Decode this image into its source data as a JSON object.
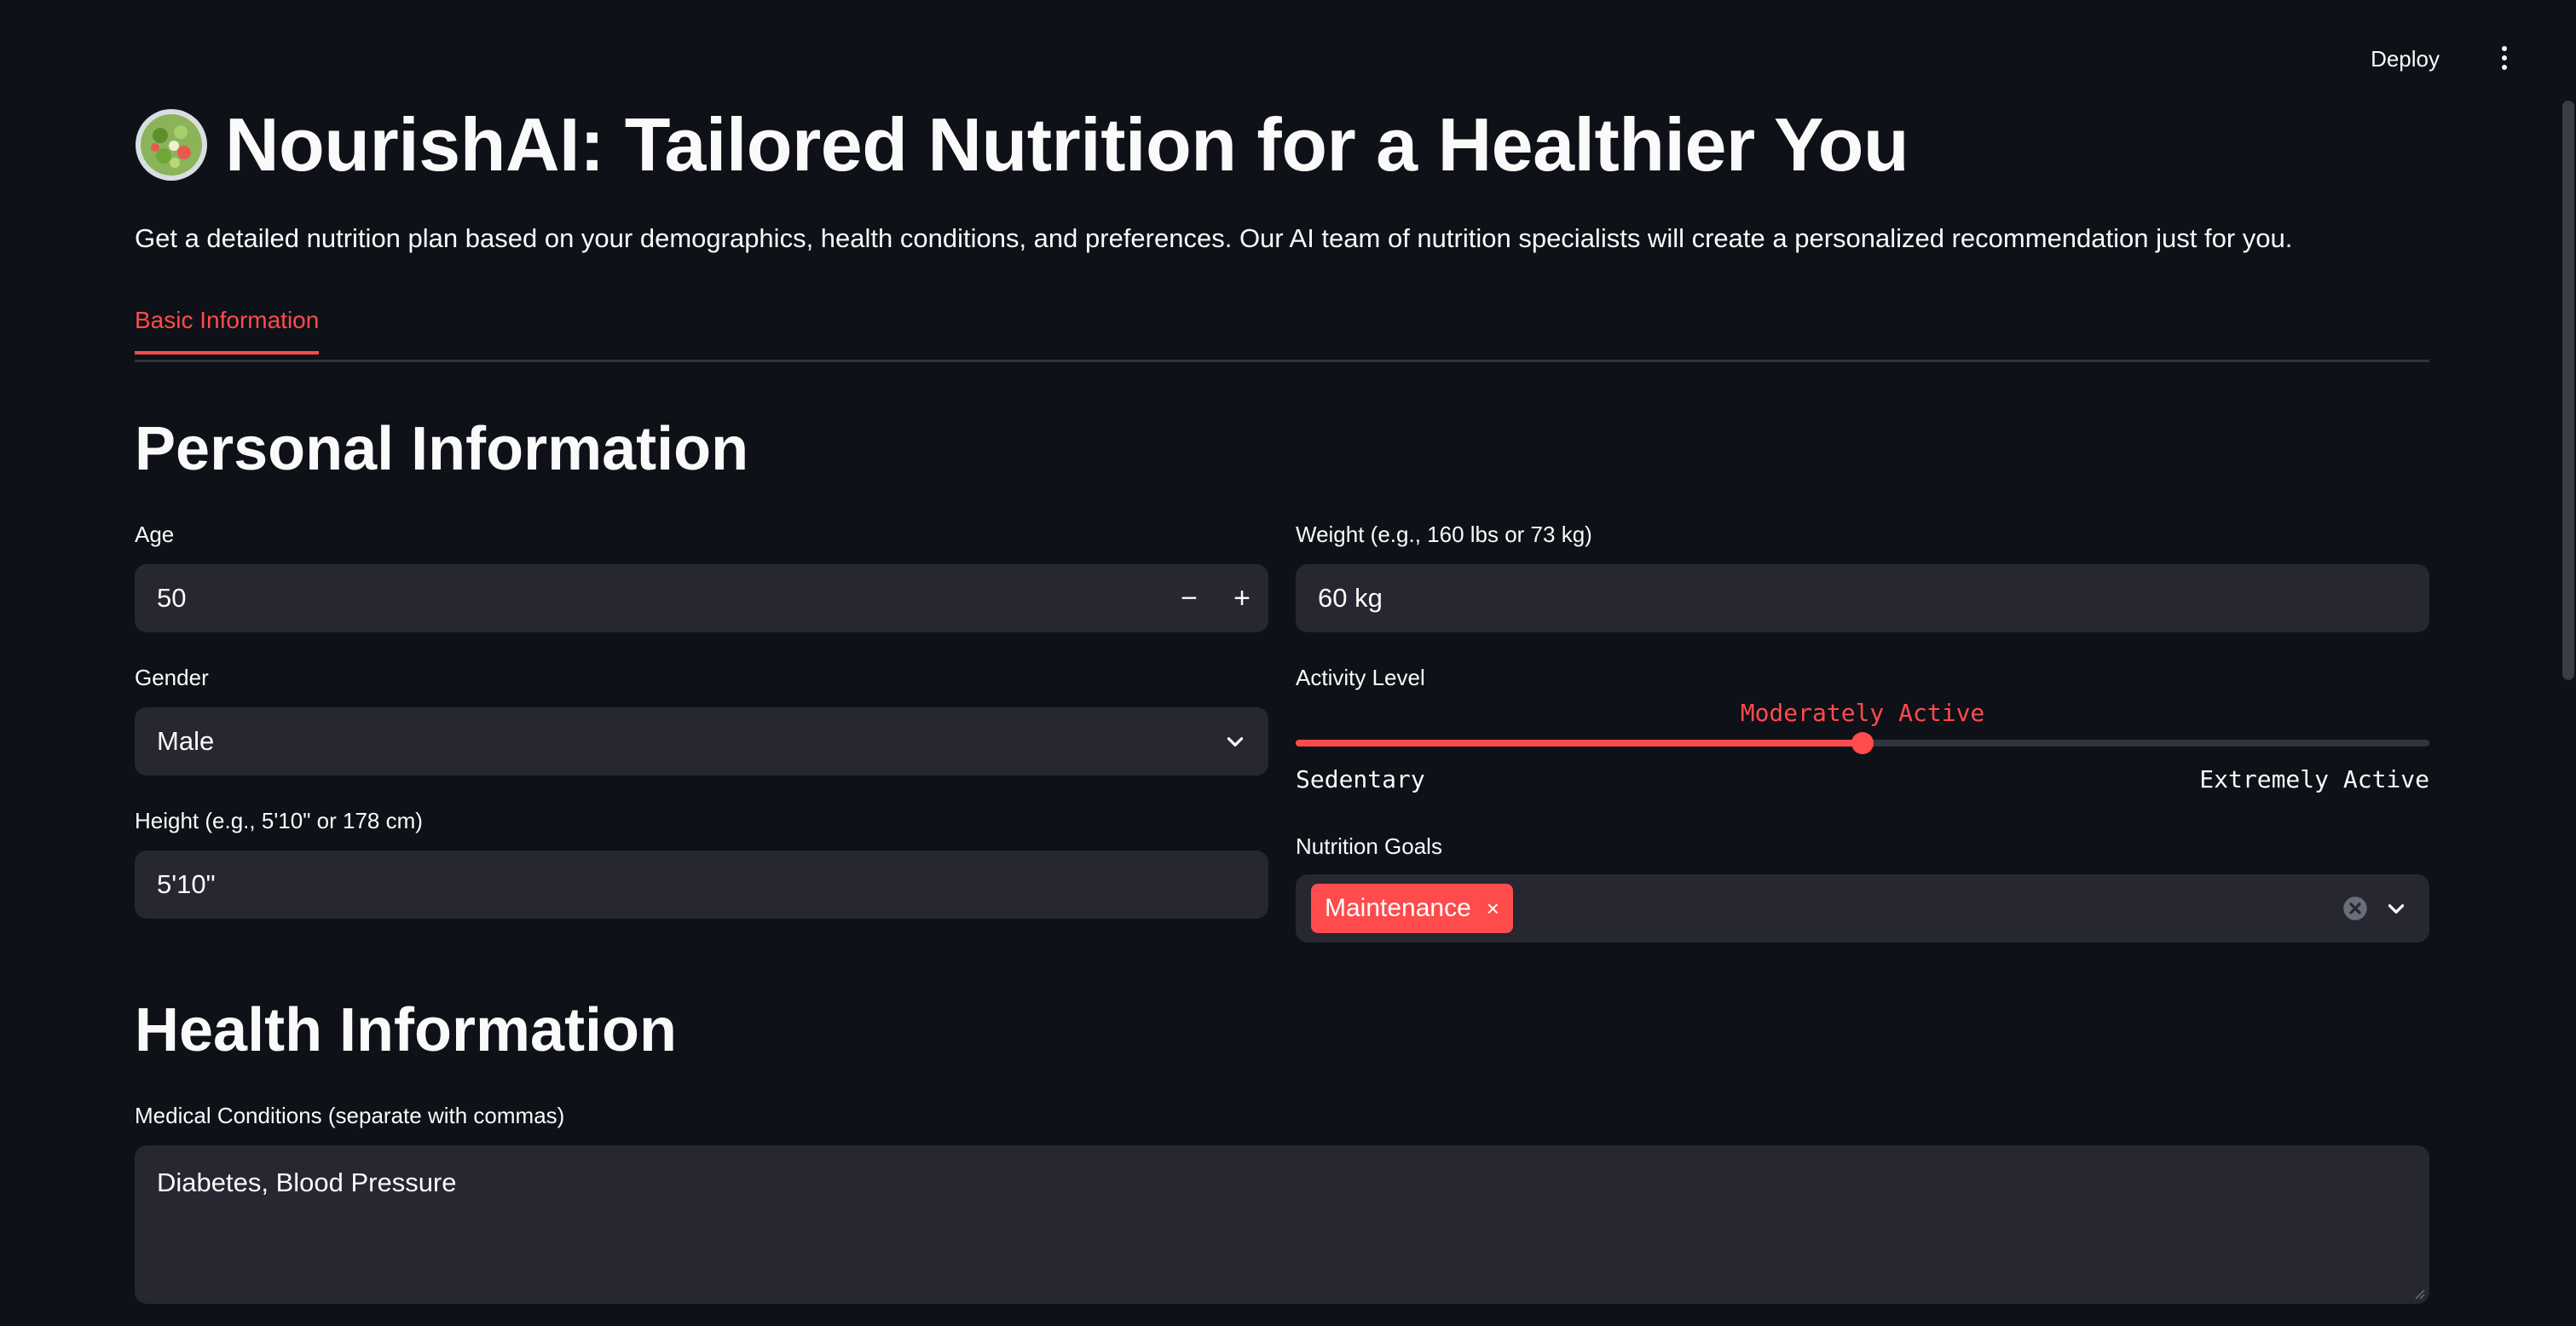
{
  "header": {
    "deploy_label": "Deploy",
    "menu_icon": "kebab-menu-icon"
  },
  "page": {
    "title_icon": "salad-bowl-icon",
    "title": "NourishAI: Tailored Nutrition for a Healthier You",
    "description": "Get a detailed nutrition plan based on your demographics, health conditions, and preferences. Our AI team of nutrition specialists will create a personalized recommendation just for you."
  },
  "tabs": [
    {
      "label": "Basic Information",
      "active": true
    }
  ],
  "personal": {
    "heading": "Personal Information",
    "age": {
      "label": "Age",
      "value": "50",
      "minus": "−",
      "plus": "+"
    },
    "weight": {
      "label": "Weight (e.g., 160 lbs or 73 kg)",
      "value": "60 kg"
    },
    "gender": {
      "label": "Gender",
      "value": "Male"
    },
    "activity": {
      "label": "Activity Level",
      "value": "Moderately Active",
      "min_label": "Sedentary",
      "max_label": "Extremely Active",
      "fraction": 0.5
    },
    "height": {
      "label": "Height (e.g., 5'10\" or 178 cm)",
      "value": "5'10\""
    },
    "goals": {
      "label": "Nutrition Goals",
      "selected": [
        "Maintenance"
      ],
      "remove_glyph": "×"
    }
  },
  "health": {
    "heading": "Health Information",
    "conditions": {
      "label": "Medical Conditions (separate with commas)",
      "value": "Diabetes, Blood Pressure"
    }
  },
  "colors": {
    "background": "#0e1117",
    "input_bg": "#262730",
    "accent": "#ff4b4b",
    "text": "#fafafa"
  }
}
